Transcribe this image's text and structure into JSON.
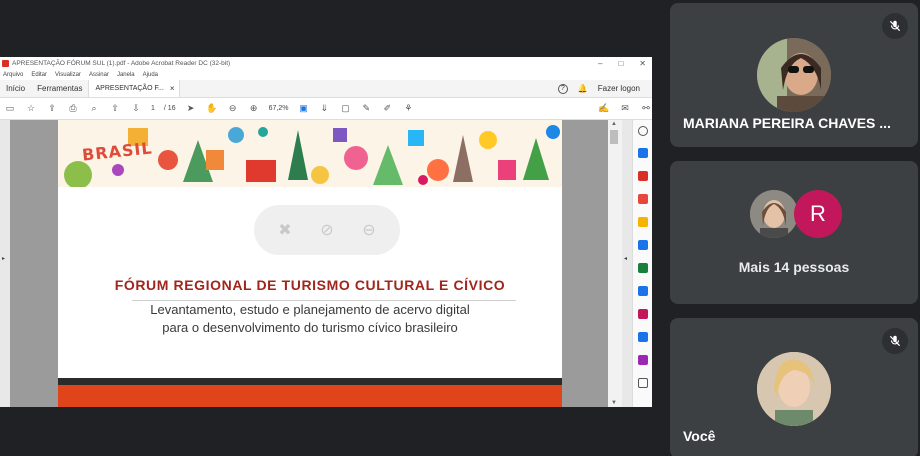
{
  "pdf_window": {
    "title": "APRESENTAÇÃO FÓRUM SUL (1).pdf - Adobe Acrobat Reader DC (32-bit)",
    "menu": [
      "Arquivo",
      "Editar",
      "Visualizar",
      "Assinar",
      "Janela",
      "Ajuda"
    ],
    "tabs": {
      "home": "Início",
      "tools": "Ferramentas",
      "document": "APRESENTAÇÃO F...",
      "close": "×"
    },
    "login": "Fazer logon",
    "help": "?",
    "page_current": "1",
    "page_total": "/ 16",
    "zoom": "67,2%",
    "doc": {
      "banner_word": "BRASIL",
      "title": "FÓRUM REGIONAL DE TURISMO CULTURAL E CÍVICO",
      "subtitle_line1": "Levantamento, estudo e planejamento de acervo digital",
      "subtitle_line2": "para o desenvolvimento do turismo cívico brasileiro"
    }
  },
  "participants": {
    "tile1_name": "MARIANA PEREIRA CHAVES ...",
    "tile2_more": "Mais 14 pessoas",
    "tile2_initial": "R",
    "tile3_name": "Você"
  },
  "colors": {
    "tile_bg": "#3c4043",
    "page_bg": "#202124",
    "title_red": "#a0251b",
    "band_orange": "#e0441b",
    "avatar_pink": "#c2185b"
  }
}
